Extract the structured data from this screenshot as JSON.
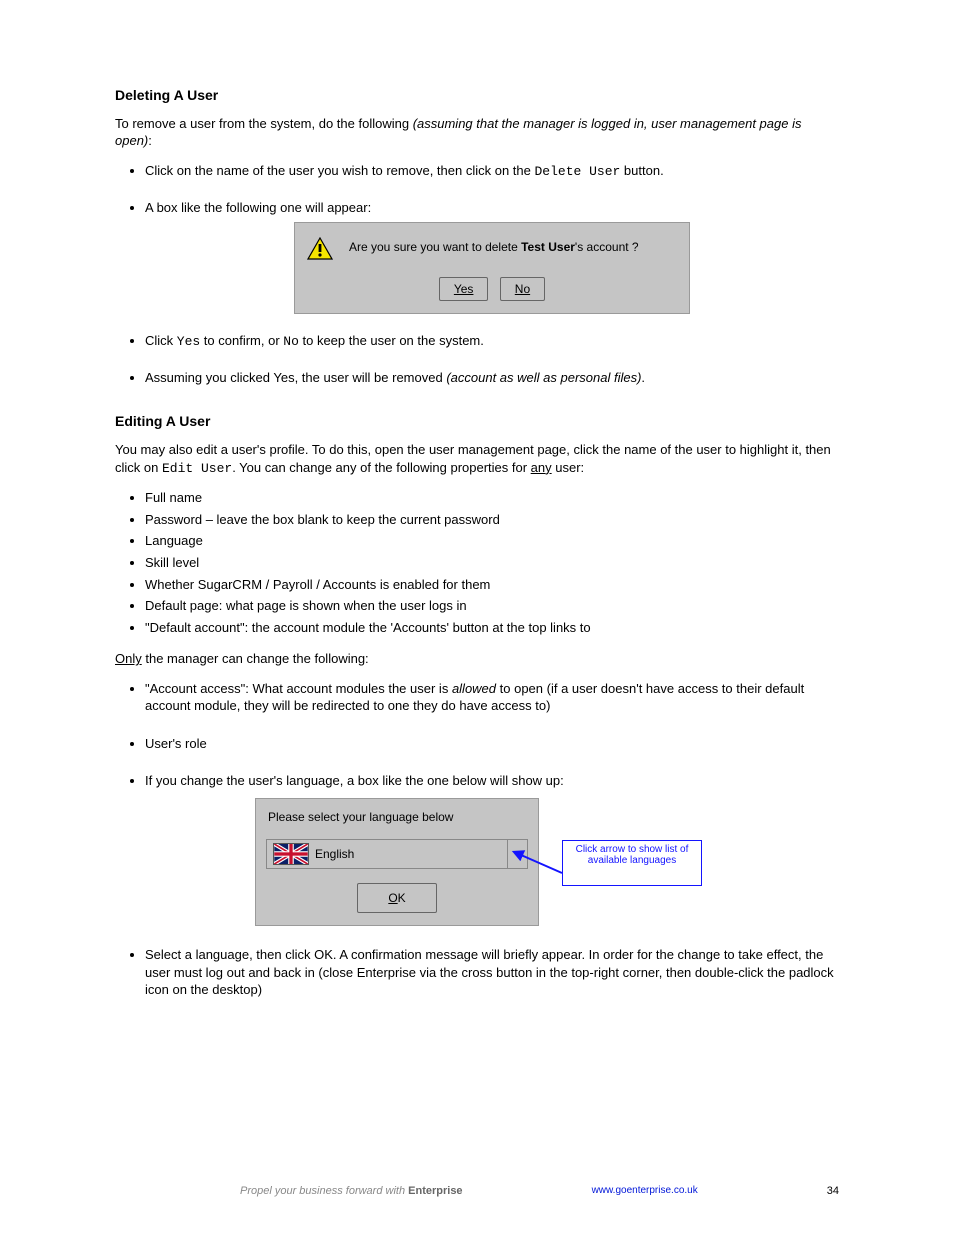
{
  "section1": {
    "heading": "Deleting A User",
    "intro_a": "To remove a user from the system, do the following ",
    "intro_b": "(assuming that the manager is logged in, user management page is open)",
    "intro_c": ":",
    "steps": [
      {
        "text_a": "Click on the name of the user you wish to remove, then click on the ",
        "text_b": "Delete User",
        "text_c": " button."
      },
      {
        "text": "A box like the following one will appear:"
      }
    ],
    "dialog": {
      "prefix": "Are you sure you want to delete ",
      "user": "Test User",
      "suffix": "'s account ?",
      "yes": "Yes",
      "no": "No"
    },
    "post": [
      {
        "text_a": "Click ",
        "text_b": "Yes",
        "text_c": " to confirm, or ",
        "text_d": "No",
        "text_e": " to keep the user on the system."
      },
      {
        "text_a": "Assuming you clicked Yes, the user will be removed ",
        "text_b": "(account as well as personal files)",
        "text_c": "."
      }
    ]
  },
  "section2": {
    "heading": "Editing A User",
    "intro_a": "You may also edit a user's profile. To do this, open the user management page, click the name of the user to highlight it, then click on ",
    "intro_b": "Edit User",
    "intro_c": ". You can change any of the following properties for ",
    "intro_d": "any",
    "intro_e": " user:",
    "props": [
      "Full name",
      "Password – leave the box blank to keep the current password",
      "Language",
      "Skill level",
      "Whether SugarCRM / Payroll / Accounts is enabled for them",
      "Default page: what page is shown when the user logs in",
      "\"Default account\": the account module the 'Accounts' button at the top links to"
    ],
    "only_intro_a": "Only",
    "only_intro_b": " the manager can change the following:",
    "mgr_props": [
      {
        "text_a": "\"Account access\": What account modules the user is ",
        "text_b": "allowed ",
        "text_c": "to open (if a user doesn't have access to their default account module, they will be redirected to one they do have access to)"
      },
      {
        "text": "User's role"
      }
    ],
    "lang_step": "If you change the user's language, a box like the one below will show up:",
    "dialog": {
      "title": "Please select your language below",
      "selected": "English",
      "ok": "OK"
    },
    "callout": "Click arrow to show list of available languages",
    "after_lang": "Select a language, then click OK. A confirmation message will briefly appear. In order for the change to take effect, the user must log out and back in (close Enterprise via the cross button in the top-right corner, then double-click the padlock icon on the desktop)"
  },
  "footer": {
    "brand_a": "Propel your business forward with ",
    "brand_b": "Enterprise",
    "link": "www.goenterprise.co.uk",
    "page": "34"
  }
}
